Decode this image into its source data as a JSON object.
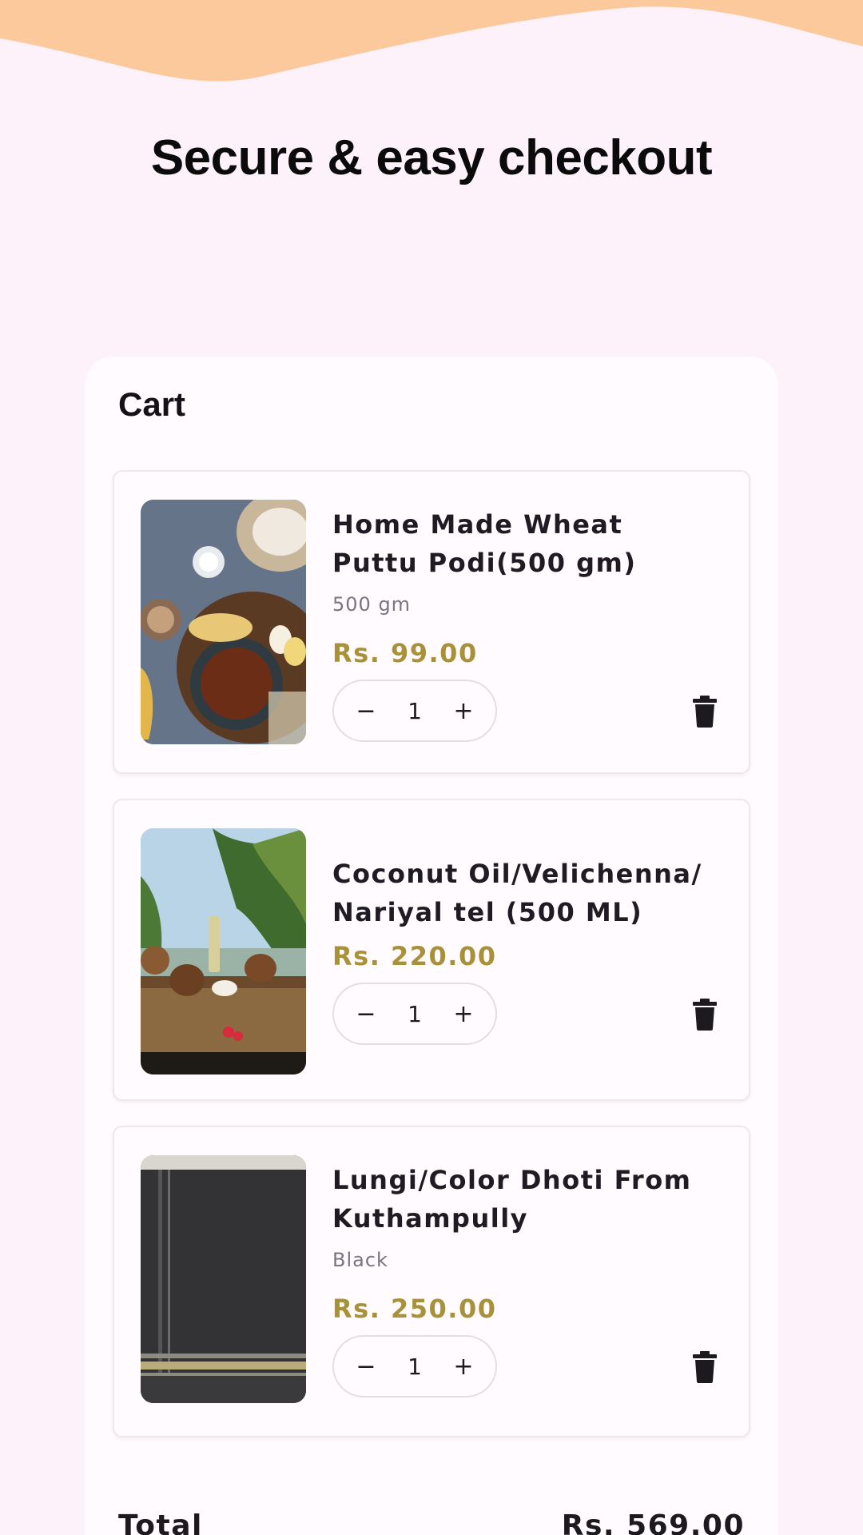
{
  "headline": "Secure & easy checkout",
  "cart": {
    "title": "Cart",
    "items": [
      {
        "name": "Home Made Wheat Puttu Podi(500 gm)",
        "variant": "500 gm",
        "price": "Rs. 99.00",
        "quantity": "1",
        "image": "puttu-breakfast-photo"
      },
      {
        "name": "Coconut Oil/Velichenna/ Nariyal tel (500 ML)",
        "variant": "",
        "price": "Rs. 220.00",
        "quantity": "1",
        "image": "coconut-oil-photo"
      },
      {
        "name": "Lungi/Color Dhoti From Kuthampully",
        "variant": "Black",
        "price": "Rs. 250.00",
        "quantity": "1",
        "image": "black-dhoti-photo"
      }
    ],
    "total_label": "Total",
    "total_value": "Rs. 569.00"
  },
  "icons": {
    "decrement": "minus-icon",
    "increment": "plus-icon",
    "delete": "trash-icon"
  },
  "colors": {
    "background": "#fdf1fa",
    "wave": "#fcc99c",
    "price": "#a9913a",
    "card": "#fffbfe"
  },
  "stepper_symbols": {
    "minus": "−",
    "plus": "+"
  }
}
